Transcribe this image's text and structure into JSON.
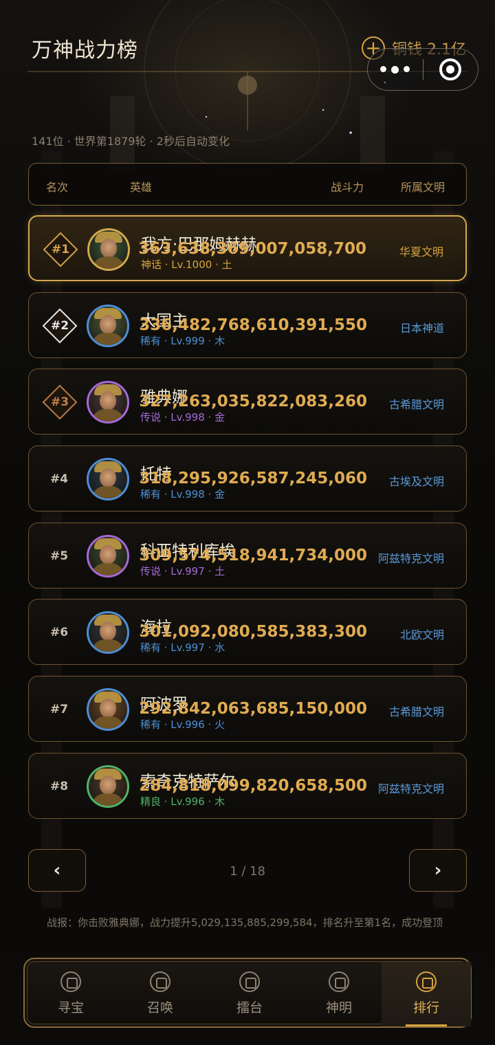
{
  "header": {
    "title": "万神战力榜",
    "currency_label": "铜钱 2.1亿",
    "subtitle": "141位 · 世界第1879轮 · 2秒后自动变化"
  },
  "table_header": {
    "rank": "名次",
    "hero": "英雄",
    "power": "战斗力",
    "civ": "所属文明"
  },
  "rows": [
    {
      "rank": "#1",
      "name": "我方·巴那姆赫赫",
      "meta": "神话 · Lv.1000 · 土",
      "power": "363,638,369,007,058,700",
      "civ": "华夏文明",
      "rarity_color": "#d7a43e",
      "civ_color": "#d7a43e"
    },
    {
      "rank": "#2",
      "name": "大国主",
      "meta": "稀有 · Lv.999 · 木",
      "power": "336,482,768,610,391,550",
      "civ": "日本神道",
      "rarity_color": "#4d8fd6",
      "civ_color": "#5a9ad8"
    },
    {
      "rank": "#3",
      "name": "雅典娜",
      "meta": "传说 · Lv.998 · 金",
      "power": "327,263,035,822,083,260",
      "civ": "古希腊文明",
      "rarity_color": "#a56ad8",
      "civ_color": "#5a9ad8"
    },
    {
      "rank": "#4",
      "name": "托特",
      "meta": "稀有 · Lv.998 · 金",
      "power": "318,295,926,587,245,060",
      "civ": "古埃及文明",
      "rarity_color": "#4d8fd6",
      "civ_color": "#5a9ad8"
    },
    {
      "rank": "#5",
      "name": "科亚特利库埃",
      "meta": "传说 · Lv.997 · 土",
      "power": "309,574,518,941,734,000",
      "civ": "阿兹特克文明",
      "rarity_color": "#a56ad8",
      "civ_color": "#5a9ad8"
    },
    {
      "rank": "#6",
      "name": "海拉",
      "meta": "稀有 · Lv.997 · 水",
      "power": "301,092,080,585,383,300",
      "civ": "北欧文明",
      "rarity_color": "#4d8fd6",
      "civ_color": "#5a9ad8"
    },
    {
      "rank": "#7",
      "name": "阿波罗",
      "meta": "稀有 · Lv.996 · 火",
      "power": "292,842,063,685,150,000",
      "civ": "古希腊文明",
      "rarity_color": "#4d8fd6",
      "civ_color": "#5a9ad8"
    },
    {
      "rank": "#8",
      "name": "索奇克特萨尔",
      "meta": "精良 · Lv.996 · 木",
      "power": "284,818,099,820,658,500",
      "civ": "阿兹特克文明",
      "rarity_color": "#4fb36a",
      "civ_color": "#5a9ad8"
    }
  ],
  "pagination": {
    "prev": "‹",
    "next": "›",
    "text": "1 / 18"
  },
  "battle_log": "战报：你击败雅典娜，战力提升5,029,135,885,299,584，排名升至第1名，成功登顶",
  "tabs": [
    {
      "label": "寻宝",
      "icon": "house-icon"
    },
    {
      "label": "召唤",
      "icon": "summon-icon"
    },
    {
      "label": "擂台",
      "icon": "arena-icon"
    },
    {
      "label": "神明",
      "icon": "deity-icon"
    },
    {
      "label": "排行",
      "icon": "ranking-icon",
      "active": true
    }
  ],
  "colors": {
    "accent": "#d7a43e",
    "power": "#e0ab52",
    "border": "#7a5e34"
  }
}
